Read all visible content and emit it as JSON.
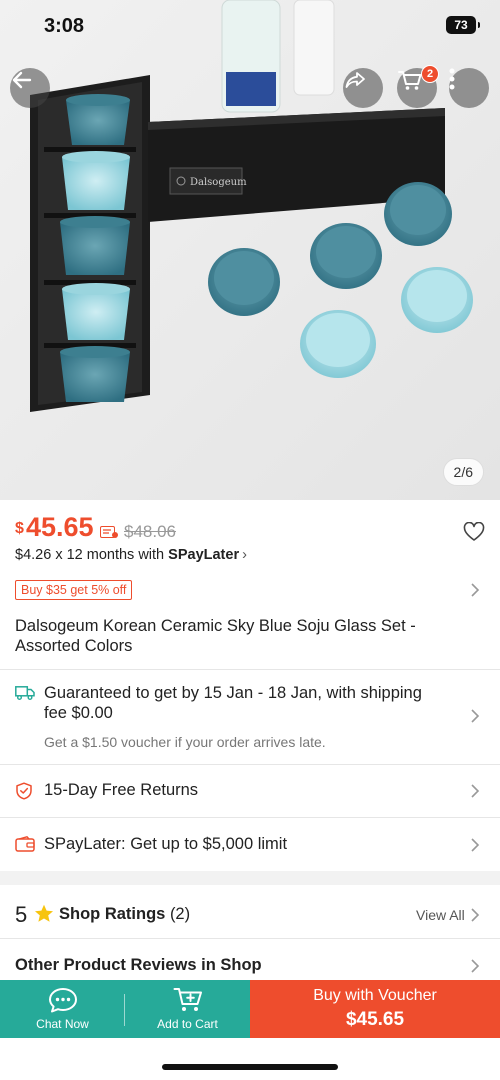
{
  "status_bar": {
    "time": "3:08",
    "battery": "73"
  },
  "gallery": {
    "counter": "2/6",
    "box_label": "Dalsogeum"
  },
  "header": {
    "cart_count": "2"
  },
  "product": {
    "currency": "$",
    "price": "45.65",
    "original_price": "$48.06",
    "installment_text": "$4.26 x 12 months with ",
    "installment_brand": "SPayLater",
    "promo": "Buy $35 get 5% off",
    "title": "Dalsogeum Korean Ceramic Sky Blue Soju Glass Set - Assorted Colors"
  },
  "shipping": {
    "line1": "Guaranteed to get by 15 Jan - 18 Jan, with shipping",
    "line2": "fee $0.00",
    "voucher_note": "Get a $1.50 voucher if your order arrives late."
  },
  "returns": {
    "label": "15-Day Free Returns"
  },
  "spaylater": {
    "label": "SPayLater: Get up to $5,000 limit"
  },
  "ratings": {
    "score": "5",
    "label": "Shop Ratings",
    "count": "(2)",
    "view_all": "View All"
  },
  "reviews": {
    "label": "Other Product Reviews in Shop"
  },
  "bottom_bar": {
    "chat_label": "Chat Now",
    "cart_label": "Add to Cart",
    "buy_line1": "Buy with Voucher",
    "buy_line2": "$45.65"
  },
  "colors": {
    "accent": "#ee4d2d",
    "teal": "#26aa99"
  }
}
